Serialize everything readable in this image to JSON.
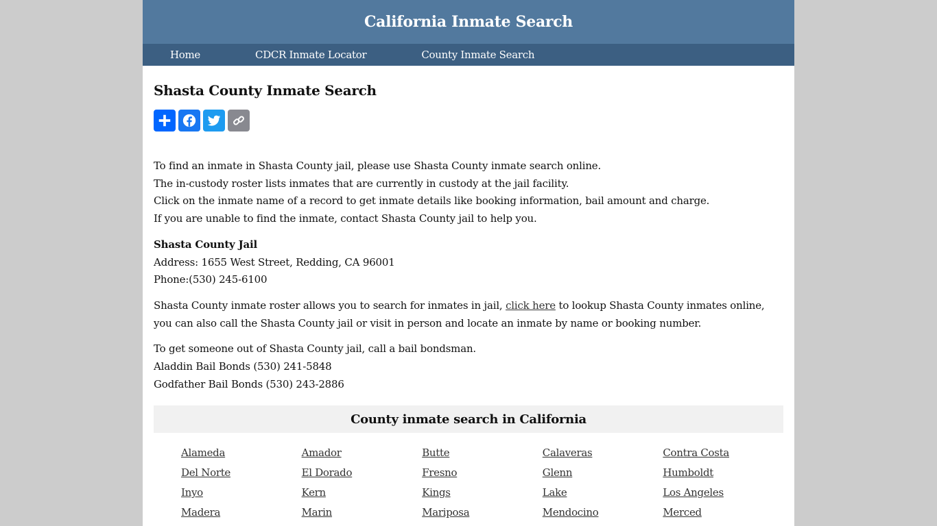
{
  "header": {
    "title": "California Inmate Search"
  },
  "nav": [
    {
      "label": "Home"
    },
    {
      "label": "CDCR Inmate Locator"
    },
    {
      "label": "County Inmate Search"
    }
  ],
  "main": {
    "title": "Shasta County Inmate Search",
    "share_buttons": [
      {
        "name": "share",
        "icon": "plus-icon",
        "color": "#0166ff"
      },
      {
        "name": "facebook",
        "icon": "facebook-icon",
        "color": "#1877f2"
      },
      {
        "name": "twitter",
        "icon": "twitter-icon",
        "color": "#1d9bf0"
      },
      {
        "name": "copy-link",
        "icon": "link-icon",
        "color": "#888990"
      }
    ],
    "intro_lines": [
      "To find an inmate in Shasta County jail, please use Shasta County inmate search online.",
      "The in-custody roster lists inmates that are currently in custody at the jail facility.",
      "Click on the inmate name of a record to get inmate details like booking information, bail amount and charge.",
      "If you are unable to find the inmate, contact Shasta County jail to help you."
    ],
    "jail": {
      "name": "Shasta County Jail",
      "address": "Address: 1655 West Street, Redding, CA 96001",
      "phone": "Phone:(530) 245-6100"
    },
    "roster": {
      "before_link": "Shasta County inmate roster allows you to search for inmates in jail, ",
      "link_text": "click here",
      "after_link": " to lookup Shasta County inmates online, you can also call the Shasta County jail or visit in person and locate an inmate by name or booking number."
    },
    "bail": {
      "intro": "To get someone out of Shasta County jail, call a bail bondsman.",
      "bondsmen": [
        "Aladdin Bail Bonds (530) 241-5848",
        "Godfather Bail Bonds (530) 243-2886"
      ]
    },
    "county_section": {
      "title": "County inmate search in California",
      "counties": [
        "Alameda",
        "Amador",
        "Butte",
        "Calaveras",
        "Contra Costa",
        "Del Norte",
        "El Dorado",
        "Fresno",
        "Glenn",
        "Humboldt",
        "Inyo",
        "Kern",
        "Kings",
        "Lake",
        "Los Angeles",
        "Madera",
        "Marin",
        "Mariposa",
        "Mendocino",
        "Merced"
      ]
    }
  }
}
